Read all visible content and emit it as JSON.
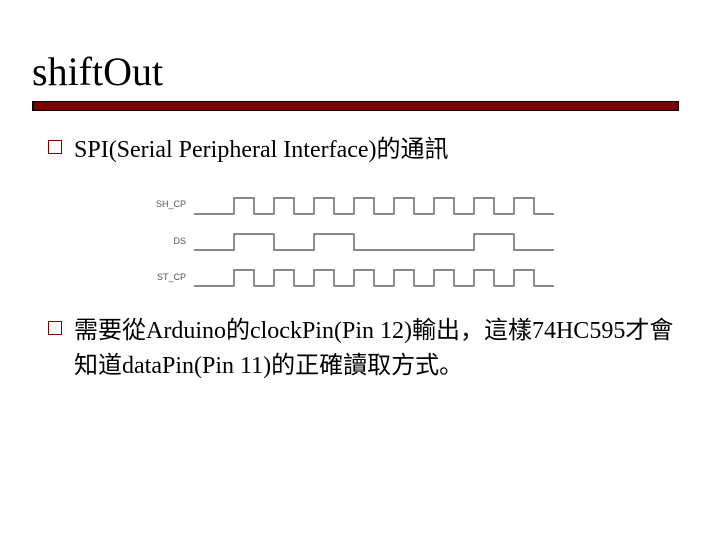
{
  "title": "shiftOut",
  "bullets": [
    "SPI(Serial Peripheral Interface)的通訊",
    "需要從Arduino的clockPin(Pin 12)輸出，這樣74HC595才會知道dataPin(Pin 11)的正確讀取方式。"
  ],
  "timing": {
    "signals": [
      {
        "name": "SH_CP",
        "pattern": "clock8"
      },
      {
        "name": "DS",
        "pattern": "data10100010"
      },
      {
        "name": "ST_CP",
        "pattern": "clock8"
      }
    ]
  }
}
